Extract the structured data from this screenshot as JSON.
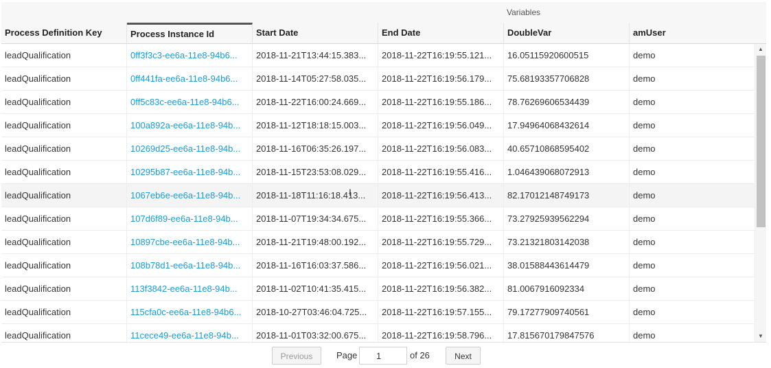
{
  "table": {
    "group_header": "Variables",
    "columns": [
      "Process Definition Key",
      "Process Instance Id",
      "Start Date",
      "End Date",
      "DoubleVar",
      "amUser"
    ],
    "rows": [
      [
        "leadQualification",
        "0ff3f3c3-ee6a-11e8-94b6...",
        "2018-11-21T13:44:15.383...",
        "2018-11-22T16:19:55.121...",
        "16.05115920600515",
        "demo"
      ],
      [
        "leadQualification",
        "0ff441fa-ee6a-11e8-94b6...",
        "2018-11-14T05:27:58.035...",
        "2018-11-22T16:19:56.179...",
        "75.68193357706828",
        "demo"
      ],
      [
        "leadQualification",
        "0ff5c83c-ee6a-11e8-94b6...",
        "2018-11-22T16:00:24.669...",
        "2018-11-22T16:19:55.186...",
        "78.76269606534439",
        "demo"
      ],
      [
        "leadQualification",
        "100a892a-ee6a-11e8-94b...",
        "2018-11-12T18:18:15.003...",
        "2018-11-22T16:19:56.049...",
        "17.94964068432614",
        "demo"
      ],
      [
        "leadQualification",
        "10269d25-ee6a-11e8-94b...",
        "2018-11-16T06:35:26.197...",
        "2018-11-22T16:19:56.083...",
        "40.65710868595402",
        "demo"
      ],
      [
        "leadQualification",
        "10295b87-ee6a-11e8-94b...",
        "2018-11-15T23:53:08.029...",
        "2018-11-22T16:19:55.416...",
        "1.046439068072913",
        "demo"
      ],
      [
        "leadQualification",
        "1067eb6e-ee6a-11e8-94b...",
        "2018-11-18T11:16:18.413...",
        "2018-11-22T16:19:56.413...",
        "82.17012148749173",
        "demo"
      ],
      [
        "leadQualification",
        "107d6f89-ee6a-11e8-94b...",
        "2018-11-07T19:34:34.675...",
        "2018-11-22T16:19:55.366...",
        "73.27925939562294",
        "demo"
      ],
      [
        "leadQualification",
        "10897cbe-ee6a-11e8-94b...",
        "2018-11-21T19:48:00.192...",
        "2018-11-22T16:19:55.729...",
        "73.21321803142038",
        "demo"
      ],
      [
        "leadQualification",
        "108b78d1-ee6a-11e8-94b...",
        "2018-11-16T16:03:37.586...",
        "2018-11-22T16:19:56.021...",
        "38.01588443614479",
        "demo"
      ],
      [
        "leadQualification",
        "113f3842-ee6a-11e8-94b...",
        "2018-11-02T10:41:35.415...",
        "2018-11-22T16:19:56.382...",
        "81.0067916092334",
        "demo"
      ],
      [
        "leadQualification",
        "115cfa0c-ee6a-11e8-94b6...",
        "2018-10-27T03:46:04.725...",
        "2018-11-22T16:19:57.155...",
        "79.17277909740561",
        "demo"
      ],
      [
        "leadQualification",
        "11cece49-ee6a-11e8-94b...",
        "2018-11-01T03:32:00.675...",
        "2018-11-22T16:19:58.796...",
        "17.815670179847576",
        "demo"
      ]
    ]
  },
  "pager": {
    "previous_label": "Previous",
    "page_label": "Page",
    "current_page": "1",
    "of_label": "of 26",
    "next_label": "Next"
  },
  "colors": {
    "link": "#1a9bd7",
    "header_bg": "#f7f7f7",
    "alt_row_bg": "#f4f4f4"
  },
  "icons": {
    "cursor": "text-cursor-icon",
    "scroll_up": "triangle-up-icon",
    "scroll_down": "triangle-down-icon"
  }
}
